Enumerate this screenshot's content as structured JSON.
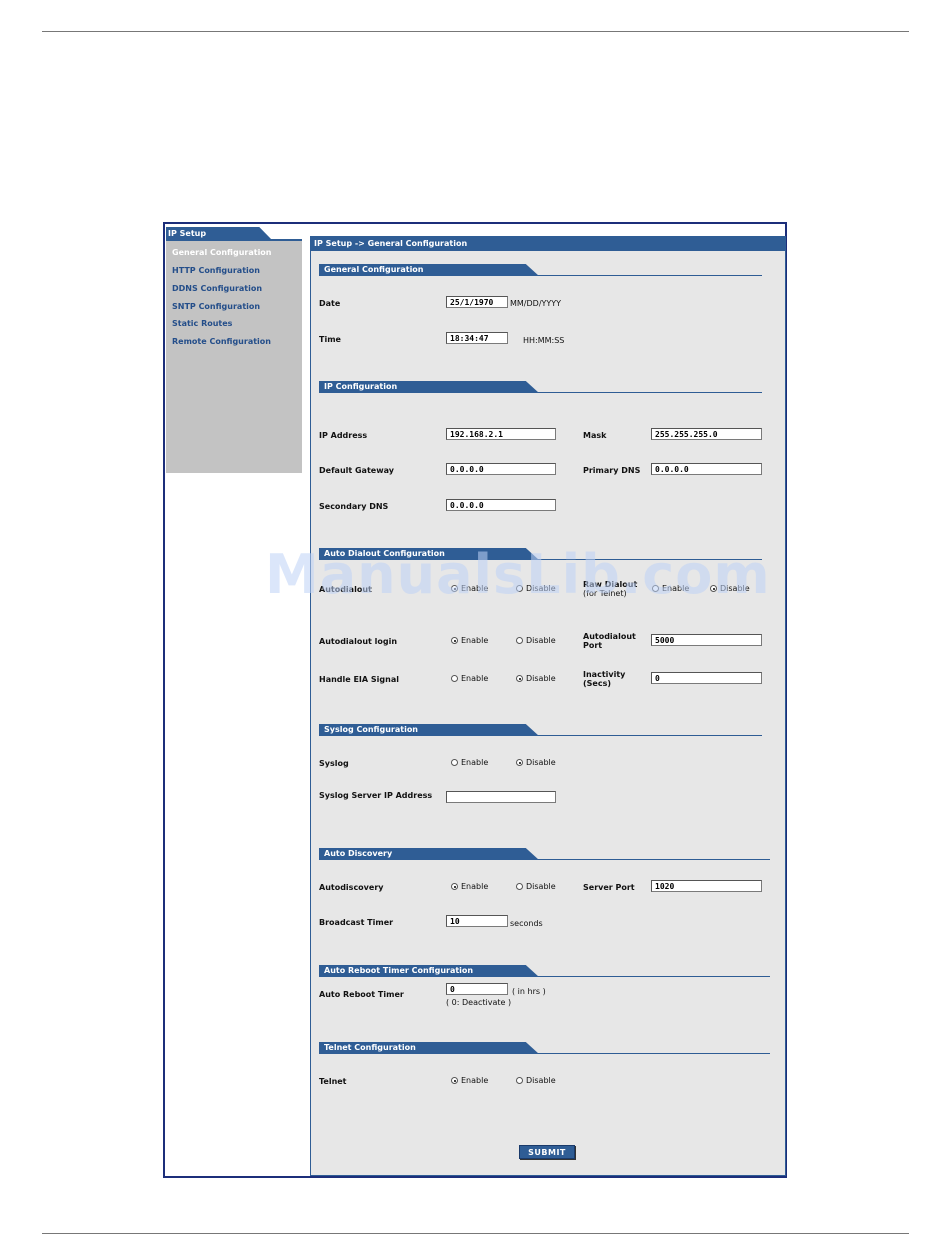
{
  "nav": {
    "tab": "IP Setup",
    "items": [
      {
        "label": "General Configuration",
        "active": true
      },
      {
        "label": "HTTP Configuration",
        "active": false
      },
      {
        "label": "DDNS Configuration",
        "active": false
      },
      {
        "label": "SNTP Configuration",
        "active": false
      },
      {
        "label": "Static Routes",
        "active": false
      },
      {
        "label": "Remote Configuration",
        "active": false
      }
    ]
  },
  "main": {
    "title": "IP Setup -> General Configuration"
  },
  "general": {
    "section": "General Configuration",
    "date_label": "Date",
    "date_value": "25/1/1970",
    "date_hint": "MM/DD/YYYY",
    "time_label": "Time",
    "time_value": "18:34:47",
    "time_hint": "HH:MM:SS"
  },
  "ip": {
    "section": "IP Configuration",
    "ip_label": "IP Address",
    "ip_value": "192.168.2.1",
    "mask_label": "Mask",
    "mask_value": "255.255.255.0",
    "gw_label": "Default Gateway",
    "gw_value": "0.0.0.0",
    "pdns_label": "Primary DNS",
    "pdns_value": "0.0.0.0",
    "sdns_label": "Secondary DNS",
    "sdns_value": "0.0.0.0"
  },
  "dialout": {
    "section": "Auto Dialout Configuration",
    "autodialout_label": "Autodialout",
    "autodialout_enable": "Enable",
    "autodialout_disable": "Disable",
    "raw_label_1": "Raw Dialout",
    "raw_label_2": "(for Telnet)",
    "raw_enable": "Enable",
    "raw_disable": "Disable",
    "login_label": "Autodialout login",
    "login_enable": "Enable",
    "login_disable": "Disable",
    "port_label_1": "Autodialout",
    "port_label_2": "Port",
    "port_value": "5000",
    "eia_label": "Handle EIA Signal",
    "eia_enable": "Enable",
    "eia_disable": "Disable",
    "inact_label_1": "Inactivity",
    "inact_label_2": "(Secs)",
    "inact_value": "0"
  },
  "syslog": {
    "section": "Syslog Configuration",
    "label": "Syslog",
    "enable": "Enable",
    "disable": "Disable",
    "server_label": "Syslog Server IP Address",
    "server_value": ""
  },
  "discovery": {
    "section": "Auto Discovery",
    "label": "Autodiscovery",
    "enable": "Enable",
    "disable": "Disable",
    "port_label": "Server Port",
    "port_value": "1020",
    "timer_label": "Broadcast Timer",
    "timer_value": "10",
    "timer_unit": "seconds"
  },
  "reboot": {
    "section": "Auto Reboot Timer Configuration",
    "label": "Auto Reboot Timer",
    "value": "0",
    "unit": "( in hrs )",
    "note": "( 0: Deactivate )"
  },
  "telnet": {
    "section": "Telnet Configuration",
    "label": "Telnet",
    "enable": "Enable",
    "disable": "Disable"
  },
  "submit_label": "SUBMIT",
  "watermark": "ManualsLib.com",
  "colors": {
    "accent": "#2f5d95",
    "frame": "#1c2e7a",
    "panel": "#e7e7e7",
    "nav": "#c3c3c3"
  }
}
